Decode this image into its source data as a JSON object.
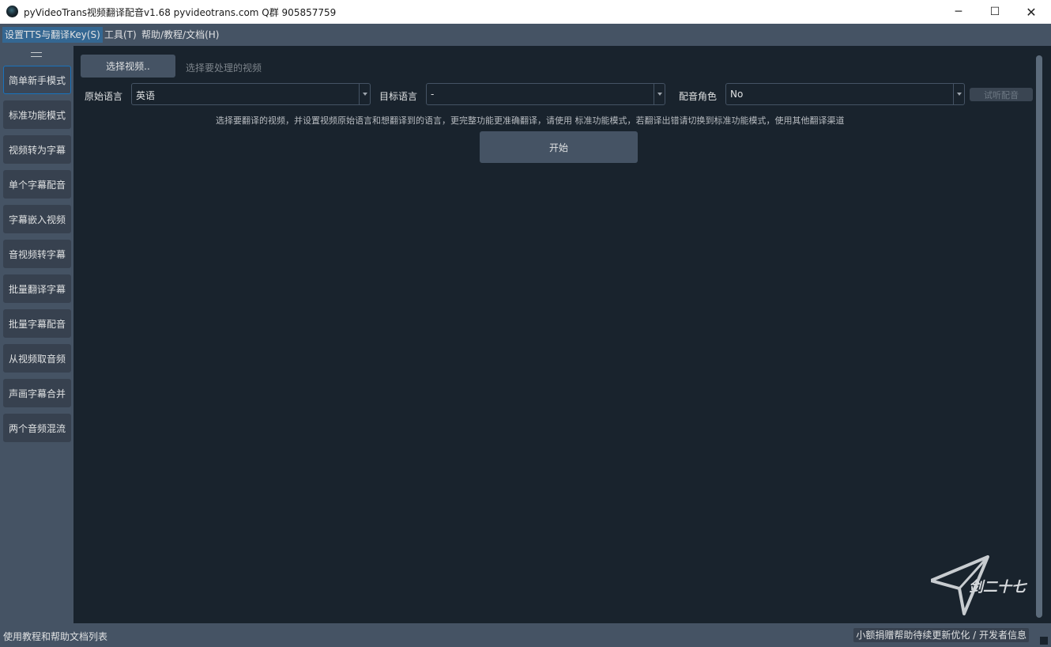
{
  "window": {
    "title": "pyVideoTrans视频翻译配音v1.68 pyvideotrans.com  Q群 905857759"
  },
  "window_controls": {
    "minimize": "─",
    "maximize": "☐",
    "close": "✕"
  },
  "menu": [
    "设置TTS与翻译Key(S)",
    "工具(T)",
    "帮助/教程/文档(H)"
  ],
  "sidebar": {
    "items": [
      "简单新手模式",
      "标准功能模式",
      "视频转为字幕",
      "单个字幕配音",
      "字幕嵌入视频",
      "音视频转字幕",
      "批量翻译字幕",
      "批量字幕配音",
      "从视频取音频",
      "声画字幕合并",
      "两个音频混流"
    ]
  },
  "main": {
    "select_video_button": "选择视频..",
    "select_video_hint": "选择要处理的视频",
    "source_language_label": "原始语言",
    "source_language_value": "英语",
    "target_language_label": "目标语言",
    "target_language_value": "-",
    "voice_role_label": "配音角色",
    "voice_role_value": "No",
    "listen_button": "试听配音",
    "info_text": "选择要翻译的视频，并设置视频原始语言和想翻译到的语言，更完整功能更准确翻译，请使用 标准功能模式，若翻译出错请切换到标准功能模式，使用其他翻译渠道",
    "start_button": "开始"
  },
  "status": {
    "left": "使用教程和帮助文档列表",
    "right": "小额捐赠帮助待续更新优化 / 开发者信息"
  },
  "watermark": {
    "text": "剑二十七"
  },
  "colors": {
    "background": "#19232d",
    "panel": "#455364",
    "accent": "#346792",
    "active_border": "#1a72bb"
  }
}
